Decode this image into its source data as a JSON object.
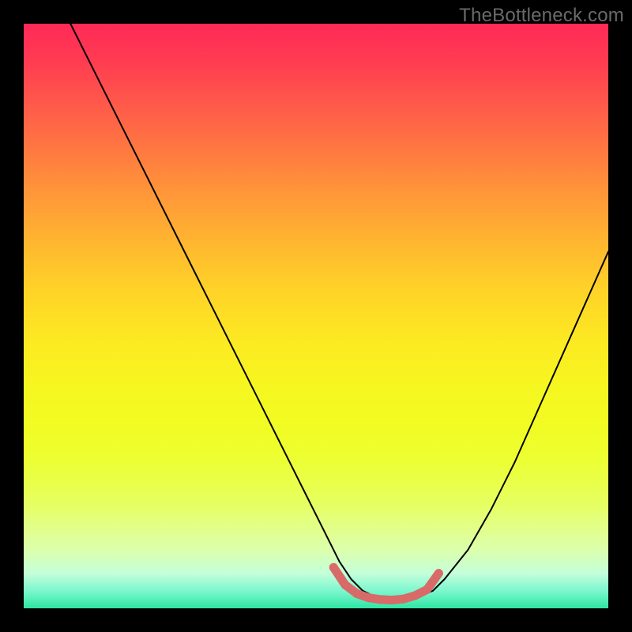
{
  "watermark": "TheBottleneck.com",
  "chart_data": {
    "type": "line",
    "title": "",
    "xlabel": "",
    "ylabel": "",
    "xlim": [
      0,
      100
    ],
    "ylim": [
      0,
      100
    ],
    "series": [
      {
        "name": "curve",
        "x": [
          8,
          12,
          16,
          20,
          24,
          28,
          32,
          36,
          40,
          44,
          48,
          52,
          54,
          56,
          58,
          60,
          62,
          64,
          66,
          68,
          70,
          72,
          76,
          80,
          84,
          88,
          92,
          96,
          100
        ],
        "y": [
          100,
          92,
          84,
          76,
          68,
          60,
          52,
          44,
          36,
          28,
          20,
          12,
          8,
          5,
          3,
          2,
          1.5,
          1.5,
          1.7,
          2.2,
          3,
          5,
          10,
          17,
          25,
          34,
          43,
          52,
          61
        ]
      },
      {
        "name": "highlight",
        "x": [
          55,
          57,
          59,
          61,
          63,
          65,
          67,
          69
        ],
        "y": [
          4,
          2.5,
          1.8,
          1.5,
          1.4,
          1.6,
          2.2,
          3.2
        ]
      }
    ],
    "gradient_stops": [
      {
        "pos": 0,
        "color": "#ff2a57"
      },
      {
        "pos": 22,
        "color": "#ff7a40"
      },
      {
        "pos": 46,
        "color": "#ffd427"
      },
      {
        "pos": 68,
        "color": "#f2fb22"
      },
      {
        "pos": 90,
        "color": "#dcffac"
      },
      {
        "pos": 100,
        "color": "#2ee6a2"
      }
    ],
    "highlight_color": "#d86a68",
    "curve_color": "#000000"
  }
}
